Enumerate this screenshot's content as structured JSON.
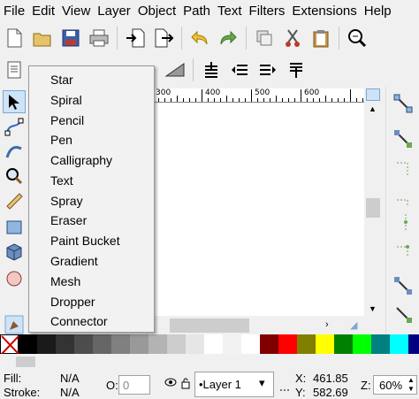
{
  "menubar": {
    "items": [
      "File",
      "Edit",
      "View",
      "Layer",
      "Object",
      "Path",
      "Text",
      "Filters",
      "Extensions",
      "Help"
    ]
  },
  "toolbar_main": {
    "icons": [
      "new-document-icon",
      "open-folder-icon",
      "save-icon",
      "print-icon",
      "import-icon",
      "export-icon",
      "undo-icon",
      "redo-icon",
      "duplicate-icon",
      "cut-icon",
      "paste-icon",
      "zoom-fit-icon"
    ]
  },
  "tool_popup": {
    "items": [
      "Star",
      "Spiral",
      "Pencil",
      "Pen",
      "Calligraphy",
      "Text",
      "Spray",
      "Eraser",
      "Paint Bucket",
      "Gradient",
      "Mesh",
      "Dropper",
      "Connector"
    ]
  },
  "ruler": {
    "labels": [
      "300",
      "400",
      "500",
      "600"
    ]
  },
  "palette": {
    "colors": [
      "#000000",
      "#1a1a1a",
      "#333333",
      "#4d4d4d",
      "#666666",
      "#808080",
      "#999999",
      "#b3b3b3",
      "#cccccc",
      "#e6e6e6",
      "#ffffff",
      "#f2f2f2",
      "#ffffff",
      "#800000",
      "#ff0000",
      "#808000",
      "#ffff00",
      "#008000",
      "#00ff00",
      "#008080",
      "#00ffff",
      "#000080"
    ]
  },
  "statusbar": {
    "fill_label": "Fill:",
    "fill_value": "N/A",
    "stroke_label": "Stroke:",
    "stroke_value": "N/A",
    "opacity_label": "O:",
    "opacity_value": "0",
    "layer_name": "•Layer 1",
    "x_label": "X:",
    "x_value": "461.85",
    "y_label": "Y:",
    "y_value": "582.69",
    "zoom_label": "Z:",
    "zoom_value": "60%"
  }
}
